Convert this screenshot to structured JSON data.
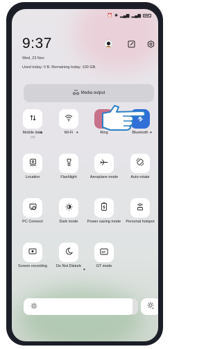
{
  "status_bar": {
    "icons": [
      "alarm-icon",
      "bluetooth-icon",
      "signal-icon",
      "signal-icon",
      "battery-icon"
    ]
  },
  "header": {
    "time": "9:37",
    "date": "Wed, 23 Nov",
    "usage": "Used today: 0 B. Remaining today: 100 GB."
  },
  "media_output": {
    "label": "Media output",
    "icon": "media-output-icon"
  },
  "tiles": [
    {
      "label": "Mobile data",
      "sub": "Off",
      "icon": "mobile-data-icon",
      "menu": true
    },
    {
      "label": "Wi-Fi",
      "icon": "wifi-icon",
      "menu": true
    },
    {
      "label": "Ring",
      "icon": "ring-icon",
      "active": true,
      "color": "#c8718b"
    },
    {
      "label": "Bluetooth",
      "icon": "bluetooth-icon",
      "active": true,
      "color": "#2f6fd7",
      "menu": true
    },
    {
      "label": "Location",
      "icon": "location-icon"
    },
    {
      "label": "Flashlight",
      "icon": "flashlight-icon"
    },
    {
      "label": "Aeroplane mode",
      "icon": "aeroplane-icon"
    },
    {
      "label": "Auto-rotate",
      "icon": "auto-rotate-icon"
    },
    {
      "label": "PC Connect",
      "icon": "pc-connect-icon"
    },
    {
      "label": "Dark mode",
      "icon": "dark-mode-icon"
    },
    {
      "label": "Power saving mode",
      "icon": "power-saving-icon"
    },
    {
      "label": "Personal hotspot",
      "icon": "hotspot-icon",
      "menu": true
    },
    {
      "label": "Screen recording",
      "icon": "screen-recording-icon"
    },
    {
      "label": "Do Not Disturb",
      "icon": "do-not-disturb-icon",
      "menu": true
    },
    {
      "label": "GT mode",
      "icon": "gt-mode-icon"
    }
  ],
  "brightness": {
    "level": 0.92,
    "icon": "brightness-icon",
    "auto_icon": "auto-brightness-icon"
  },
  "overlay": {
    "icon": "pointing-hand-icon"
  }
}
